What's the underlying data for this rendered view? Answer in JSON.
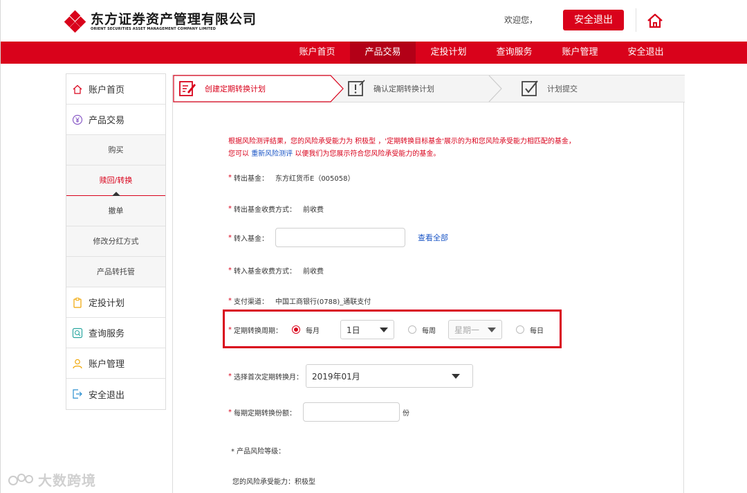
{
  "header": {
    "company_cn": "东方证券资产管理有限公司",
    "company_en": "ORIENT SECURITIES ASSET MANAGEMENT COMPANY LIMITED",
    "welcome": "欢迎您，",
    "logout_label": "安全退出",
    "home_icon": "home-icon"
  },
  "nav": {
    "items": [
      "账户首页",
      "产品交易",
      "定投计划",
      "查询服务",
      "账户管理",
      "安全退出"
    ],
    "active_index": 1
  },
  "sidebar": {
    "items": [
      {
        "label": "账户首页",
        "icon": "home-icon"
      },
      {
        "label": "产品交易",
        "icon": "yen-icon"
      },
      {
        "label": "定投计划",
        "icon": "clipboard-icon"
      },
      {
        "label": "查询服务",
        "icon": "search-icon"
      },
      {
        "label": "账户管理",
        "icon": "user-icon"
      },
      {
        "label": "安全退出",
        "icon": "exit-icon"
      }
    ],
    "sub_items": [
      "购买",
      "赎回/转换",
      "撤单",
      "修改分红方式",
      "产品转托管"
    ],
    "active_sub_index": 1
  },
  "steps": [
    {
      "label": "创建定期转换计划",
      "icon": "edit-icon"
    },
    {
      "label": "确认定期转换计划",
      "icon": "warning-icon"
    },
    {
      "label": "计划提交",
      "icon": "check-icon"
    }
  ],
  "notice": {
    "line1": "根据风险测评结果，您的风险承受能力为 积极型 ，'定期转换目标基金'展示的为和您风险承受能力相匹配的基金，",
    "line2_prefix": "您可以 ",
    "line2_link": "重新风险测评",
    "line2_suffix": " 以便我们为您展示符合您风险承受能力的基金。"
  },
  "form": {
    "out_fund_label": "转出基金：",
    "out_fund_value": "东方红货币E（005058）",
    "out_fee_label": "转出基金收费方式：",
    "out_fee_value": "前收费",
    "in_fund_label": "转入基金：",
    "in_fund_value": "",
    "view_all": "查看全部",
    "in_fee_label": "转入基金收费方式：",
    "in_fee_value": "前收费",
    "pay_label": "支付渠道：",
    "pay_value": "中国工商银行(0788)_通联支付",
    "cycle_label": "定期转换周期：",
    "cycle_monthly": "每月",
    "cycle_day_value": "1日",
    "cycle_weekly": "每周",
    "cycle_weekday_value": "星期一",
    "cycle_daily": "每日",
    "cycle_selected": "每月",
    "first_month_label": "选择首次定期转换月：",
    "first_month_value": "2019年01月",
    "shares_label": "每期定期转换份额：",
    "shares_value": "",
    "shares_unit": "份",
    "risk_level_label": "* 产品风险等级：",
    "user_risk_label": "您的风险承受能力：",
    "user_risk_value": "积极型"
  },
  "watermark": "大数跨境",
  "colors": {
    "brand_red": "#d9021b",
    "link_blue": "#1b56c6"
  }
}
